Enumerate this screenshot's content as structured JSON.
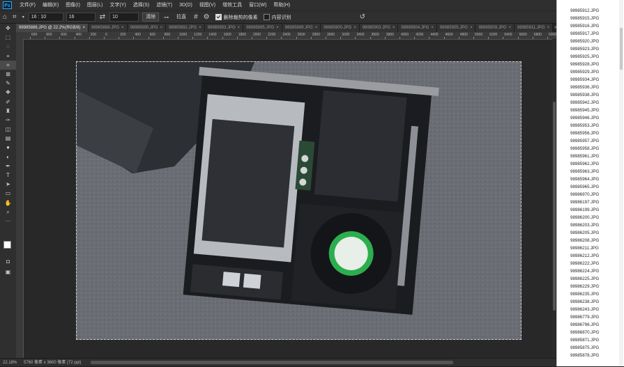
{
  "app": {
    "logo": "Ps"
  },
  "menu": [
    "文件(F)",
    "编辑(E)",
    "图像(I)",
    "图层(L)",
    "文字(Y)",
    "选择(S)",
    "滤镜(T)",
    "3D(D)",
    "视图(V)",
    "增效工具",
    "窗口(W)",
    "帮助(H)"
  ],
  "options": {
    "ratio": "16 : 10",
    "width": "16",
    "height": "10",
    "clear": "清除",
    "straighten": "拉直",
    "delete_cropped": "删除裁剪的像素",
    "content_aware": "内容识别"
  },
  "tabs": [
    "98985886.JPG @ 22.2%(RGB/8)",
    "98985888.JPG",
    "98985890.JPG",
    "98985892.JPG",
    "98985893.JPG",
    "98985895.JPG",
    "98985899.JPG",
    "98985900.JPG",
    "98985903.JPG",
    "98985904.JPG",
    "98985905.JPG",
    "98985909.JPG",
    "98985911.JPG"
  ],
  "tab_more": "»",
  "ruler_labels": [
    "600",
    "800",
    "600",
    "400",
    "200",
    "0",
    "200",
    "400",
    "600",
    "800",
    "1000",
    "1200",
    "1400",
    "1600",
    "1800",
    "2000",
    "2200",
    "2400",
    "2600",
    "2800",
    "3000",
    "3200",
    "3400",
    "3600",
    "3800",
    "4000",
    "4200",
    "4400",
    "4600",
    "4800",
    "5000",
    "5200",
    "5400",
    "5600",
    "5800",
    "6000"
  ],
  "status": {
    "zoom": "22.18%",
    "doc_size": "5760 像素 x 3600 像素 (72 ppi)"
  },
  "files": [
    "98985912.JPG",
    "98985915.JPG",
    "98985916.JPG",
    "98985917.JPG",
    "98985920.JPG",
    "98985923.JPG",
    "98985925.JPG",
    "98985928.JPG",
    "98985929.JPG",
    "98985934.JPG",
    "98985936.JPG",
    "98985938.JPG",
    "98985942.JPG",
    "98985945.JPG",
    "98985946.JPG",
    "98985953.JPG",
    "98985956.JPG",
    "98985957.JPG",
    "98985958.JPG",
    "98985961.JPG",
    "98985962.JPG",
    "98985963.JPG",
    "98985964.JPG",
    "98985965.JPG",
    "98986970.JPG",
    "98986197.JPG",
    "98986199.JPG",
    "98986200.JPG",
    "98986203.JPG",
    "98986205.JPG",
    "98986208.JPG",
    "98986211.JPG",
    "98986212.JPG",
    "98986222.JPG",
    "98986224.JPG",
    "98986225.JPG",
    "98986229.JPG",
    "98986235.JPG",
    "98986238.JPG",
    "98986243.JPG",
    "98986779.JPG",
    "98986796.JPG",
    "98986870.JPG",
    "98985871.JPG",
    "98985875.JPG",
    "98985878.JPG"
  ]
}
